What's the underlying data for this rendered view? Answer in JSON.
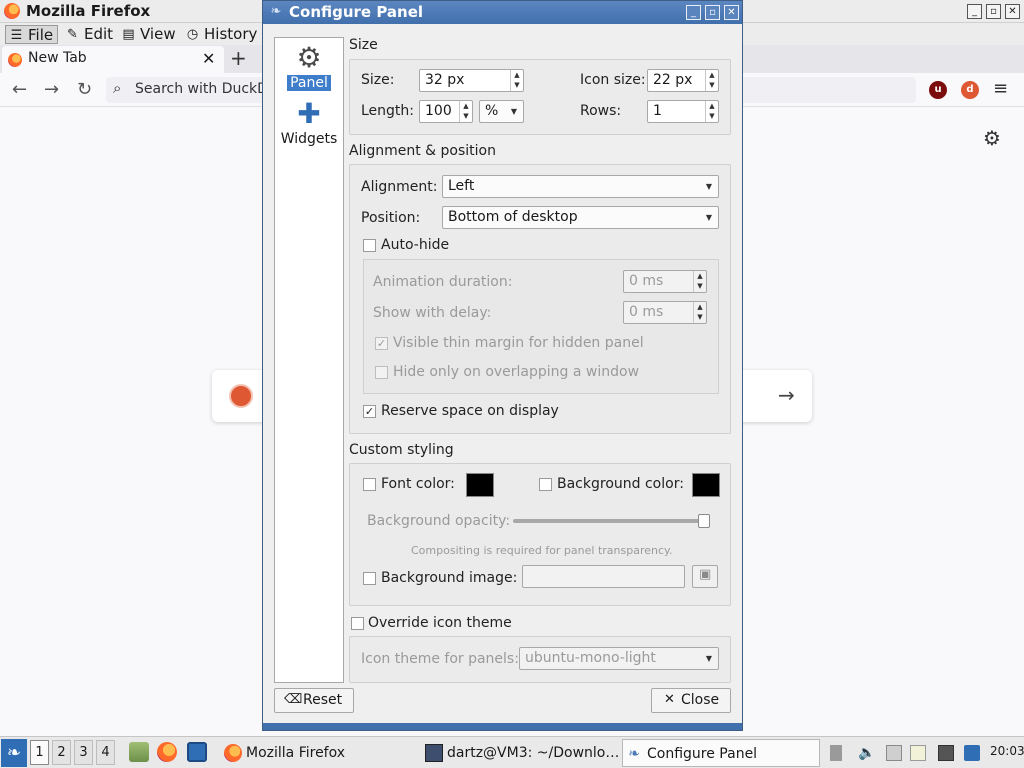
{
  "firefox": {
    "window_title": "Mozilla Firefox",
    "menu": {
      "file": "File",
      "edit": "Edit",
      "view": "View",
      "history": "History"
    },
    "tab_label": "New Tab",
    "search_placeholder": "Search with DuckD"
  },
  "dialog": {
    "title": "Configure Panel",
    "sidebar": {
      "panel": "Panel",
      "widgets": "Widgets"
    },
    "size": {
      "header": "Size",
      "size_label": "Size:",
      "size_value": "32 px",
      "icon_size_label": "Icon size:",
      "icon_size_value": "22 px",
      "length_label": "Length:",
      "length_value": "100",
      "length_unit": "%",
      "rows_label": "Rows:",
      "rows_value": "1"
    },
    "alignment": {
      "header": "Alignment & position",
      "alignment_label": "Alignment:",
      "alignment_value": "Left",
      "position_label": "Position:",
      "position_value": "Bottom of desktop",
      "autohide_label": "Auto-hide",
      "autohide_checked": false,
      "anim_label": "Animation duration:",
      "anim_value": "0 ms",
      "delay_label": "Show with delay:",
      "delay_value": "0 ms",
      "thin_margin_label": "Visible thin margin for hidden panel",
      "thin_margin_checked": true,
      "overlap_label": "Hide only on overlapping a window",
      "overlap_checked": false,
      "reserve_label": "Reserve space on display",
      "reserve_checked": true
    },
    "styling": {
      "header": "Custom styling",
      "font_color_label": "Font color:",
      "font_color": "#000000",
      "bg_color_label": "Background color:",
      "bg_color": "#000000",
      "opacity_label": "Background opacity:",
      "opacity": 1.0,
      "compositing_note": "Compositing is required for panel transparency.",
      "bg_image_label": "Background image:",
      "bg_image_value": ""
    },
    "icon_theme": {
      "override_label": "Override icon theme",
      "override_checked": false,
      "theme_label": "Icon theme for panels:",
      "theme_value": "ubuntu-mono-light"
    },
    "buttons": {
      "reset": "Reset",
      "close": "Close"
    }
  },
  "taskbar": {
    "workspaces": [
      "1",
      "2",
      "3",
      "4"
    ],
    "tasks": [
      {
        "label": "Mozilla Firefox",
        "icon": "firefox-icon"
      },
      {
        "label": "dartz@VM3: ~/Downlo…",
        "icon": "terminal-icon"
      },
      {
        "label": "Configure Panel",
        "icon": "settings-icon"
      }
    ],
    "clock": "20:03"
  },
  "colors": {
    "accent": "#3d7dca",
    "titlebar": "#4a78b5"
  }
}
